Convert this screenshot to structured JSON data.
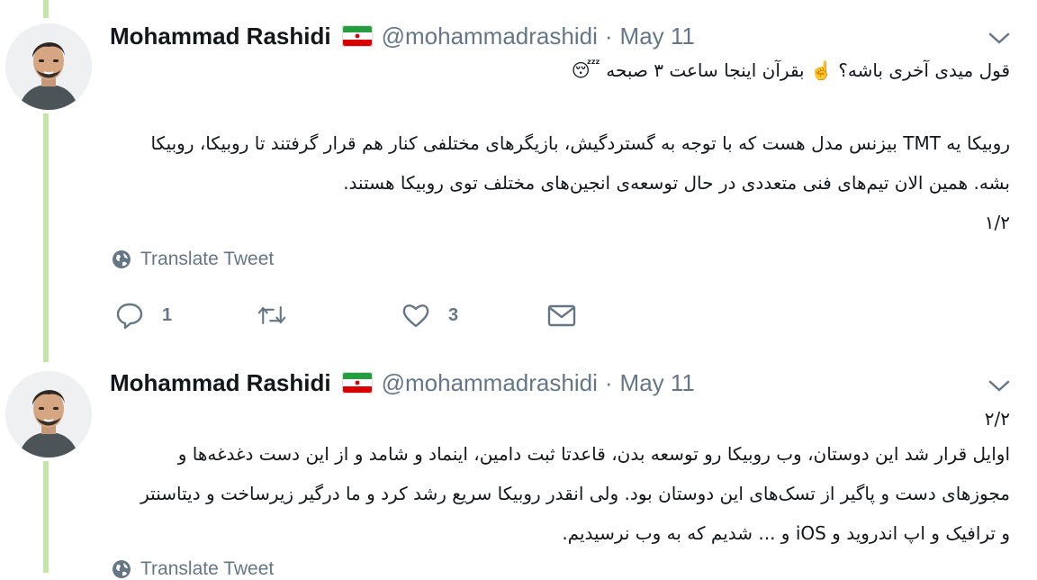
{
  "tweets": [
    {
      "author_name": "Mohammad Rashidi",
      "handle": "@mohammadrashidi",
      "separator": "·",
      "date": "May 11",
      "text_line1": "قول میدی آخری باشه؟ ☝️ بقرآن اینجا ساعت ۳ صبحه 😴",
      "text_paragraph": "روبیکا یه TMT بیزنس مدل هست که با توجه به گستردگیش، بازیگرهای مختلفی کنار هم قرار گرفتند تا روبیکا، روبیکا بشه. همین الان تیم‌های فنی متعددی در حال توسعه‌ی انجین‌های مختلف توی روبیکا هستند.",
      "text_page": "۱/۲",
      "translate_label": "Translate Tweet",
      "reply_count": "1",
      "like_count": "3"
    },
    {
      "author_name": "Mohammad Rashidi",
      "handle": "@mohammadrashidi",
      "separator": "·",
      "date": "May 11",
      "text_page": "۲/۲",
      "text_paragraph": "اوایل قرار شد این دوستان، وب روبیکا رو توسعه بدن، قاعدتا ثبت دامین، اینماد و شامد و از این دست دغدغه‌ها و مجوزهای دست و پاگیر از تسک‌های این دوستان بود. ولی انقدر روبیکا سریع رشد کرد و ما درگیر زیرساخت و دیتاسنتر و ترافیک و اپ اندروید و iOS و ... شدیم که به وب نرسیدیم.",
      "translate_label": "Translate Tweet"
    }
  ],
  "icons": {
    "flag": "iran-flag-icon",
    "chevron": "chevron-down-icon",
    "globe": "globe-icon",
    "reply": "reply-icon",
    "retweet": "retweet-icon",
    "like": "heart-icon",
    "dm": "envelope-icon"
  },
  "colors": {
    "thread_line": "#c3e6a8",
    "secondary_text": "#657786",
    "primary_text": "#14171a"
  }
}
